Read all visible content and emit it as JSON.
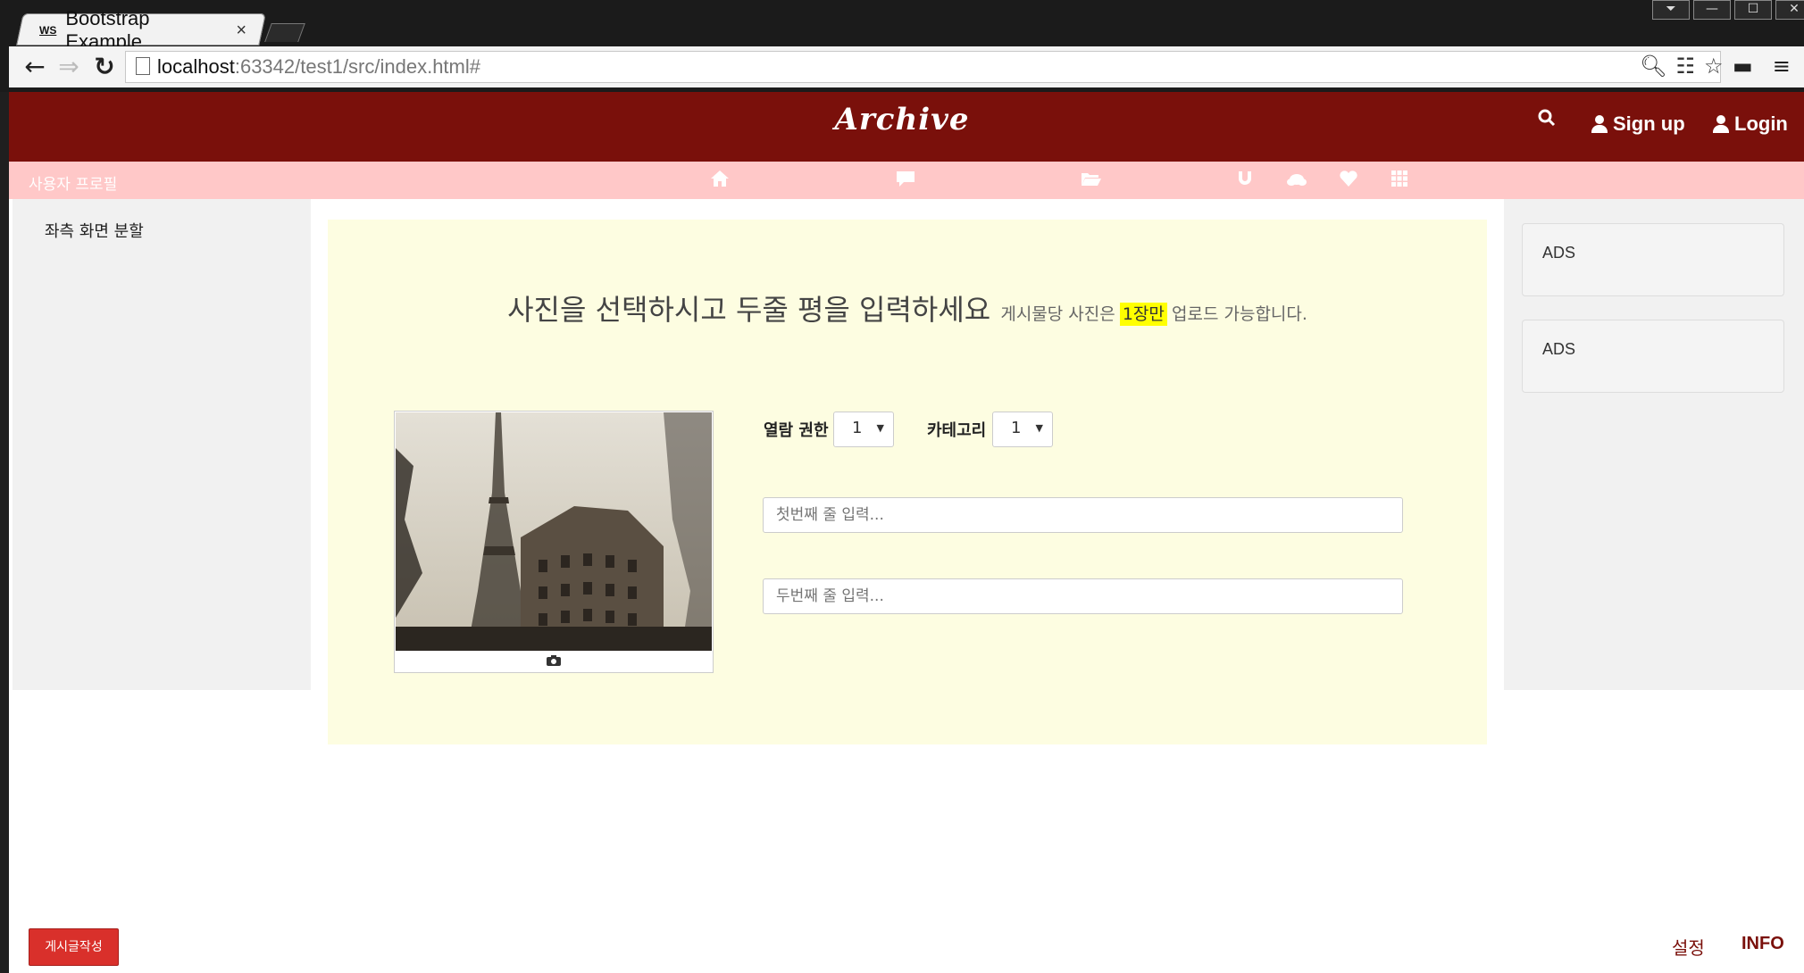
{
  "browser": {
    "tab_title": "Bootstrap Example",
    "tab_badge": "WS",
    "tab_close": "×",
    "url_host": "localhost",
    "url_path": ":63342/test1/src/index.html#",
    "window_buttons": [
      "⏷",
      "—",
      "☐",
      "✕"
    ]
  },
  "navbar": {
    "logo": "Archive",
    "signup_label": "Sign up",
    "login_label": "Login",
    "background_color": "#7a100b"
  },
  "subnav": {
    "profile_label": "사용자 프로필",
    "icons": [
      "home-icon",
      "comment-icon",
      "folder-open-icon",
      "magnet-icon",
      "cloud-icon",
      "heart-icon",
      "grid-icon"
    ],
    "background_color": "#ffc8c8"
  },
  "left_sidebar": {
    "text": "좌측 화면 분할"
  },
  "right_sidebar": {
    "ads": [
      "ADS",
      "ADS"
    ]
  },
  "main": {
    "headline": "사진을 선택하시고 두줄 평을 입력하세요",
    "subtext_before": "게시물당 사진은",
    "subtext_highlight": "1장만",
    "subtext_after": "업로드 가능합니다.",
    "permission_label": "열람 권한",
    "permission_value": "1",
    "category_label": "카테고리",
    "category_value": "1",
    "line1_placeholder": "첫번째 줄 입력...",
    "line2_placeholder": "두번째 줄 입력..."
  },
  "footer": {
    "write_button": "게시글작성",
    "settings_label": "설정",
    "info_label": "INFO"
  }
}
